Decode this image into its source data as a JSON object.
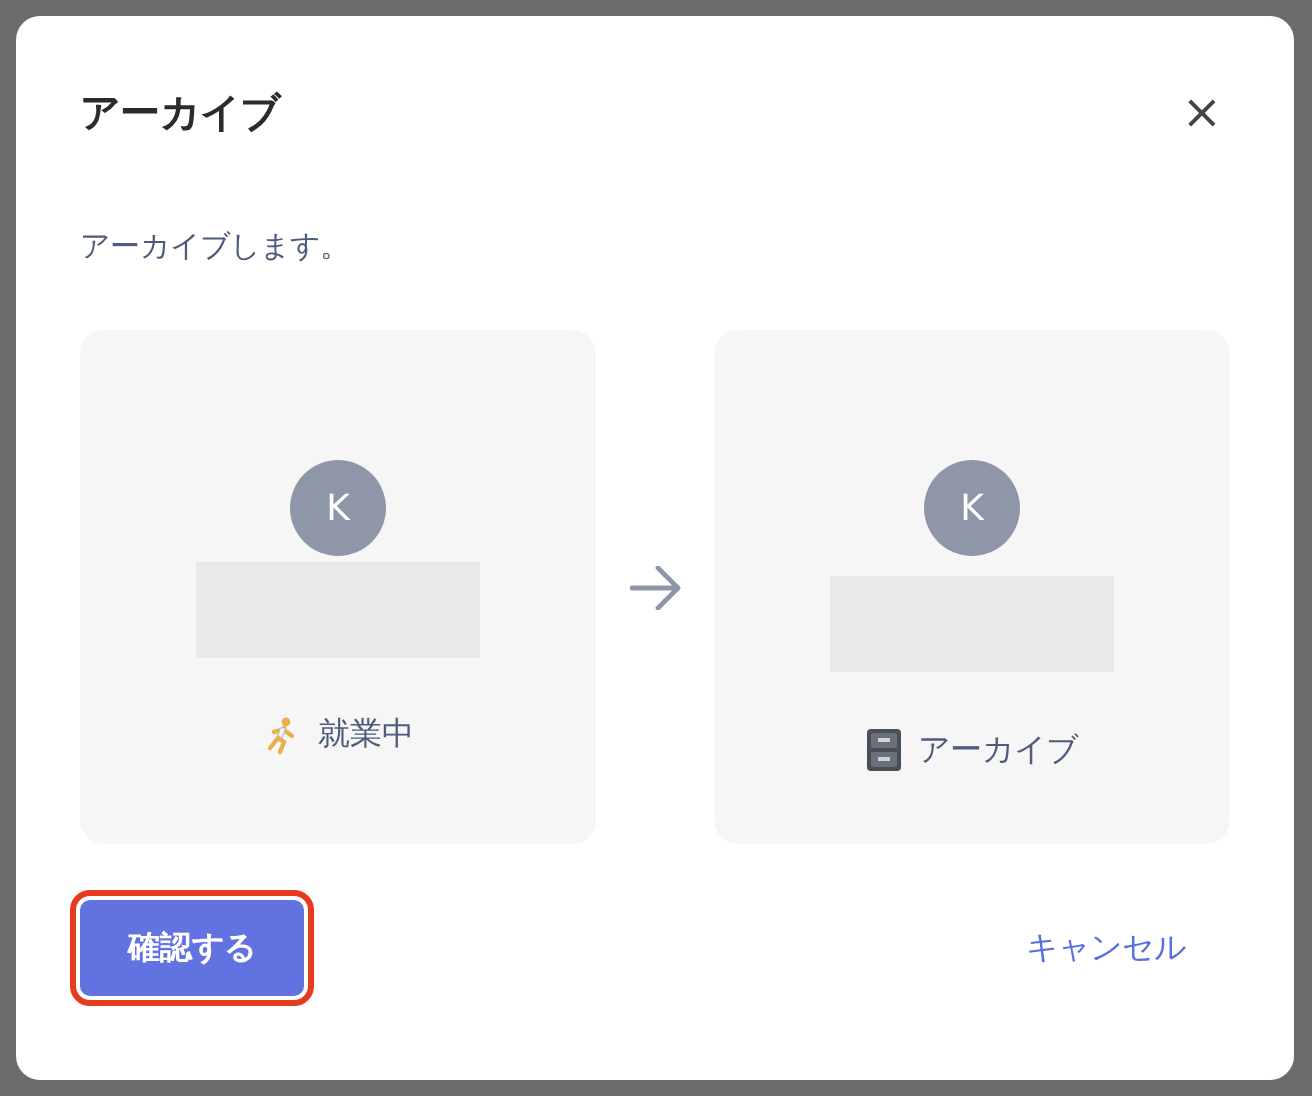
{
  "dialog": {
    "title": "アーカイブ",
    "close": "×",
    "message": "アーカイブします。"
  },
  "cards": [
    {
      "kind": "working",
      "initial": "K",
      "status": "就業中"
    },
    {
      "kind": "archived",
      "initial": "K",
      "status": "アーカイブ"
    }
  ],
  "confirm_button": {
    "label": "確認する",
    "highlighted": true
  },
  "cancel_button": {
    "label": "キャンセル"
  }
}
